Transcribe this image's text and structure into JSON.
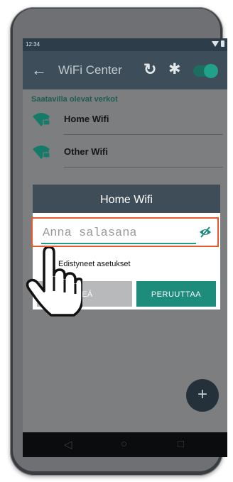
{
  "status_bar": {
    "time": "12:34"
  },
  "app_bar": {
    "title": "WiFi Center",
    "back_icon": "arrow-left-icon",
    "refresh_icon": "refresh-icon",
    "settings_icon": "gear-icon",
    "wifi_enabled": true
  },
  "networks": {
    "section_label": "Saatavilla olevat verkot",
    "items": [
      {
        "label": "Home Wifi",
        "icon": "wifi-locked-icon"
      },
      {
        "label": "Other Wifi",
        "icon": "wifi-locked-icon"
      }
    ]
  },
  "dialog": {
    "title": "Home Wifi",
    "password_placeholder": "Anna salasana",
    "password_value": "",
    "advanced_label": "Edistyneet asetukset",
    "ok_label": "KEÄ",
    "cancel_label": "PERUUTTAA"
  },
  "fab": {
    "label": "+"
  },
  "nav_bar": {
    "back": "◁",
    "home": "○",
    "recents": "□"
  },
  "colors": {
    "accent": "#1e8c7a",
    "highlight": "#e65a2e",
    "appbar": "#3d4e5a"
  }
}
